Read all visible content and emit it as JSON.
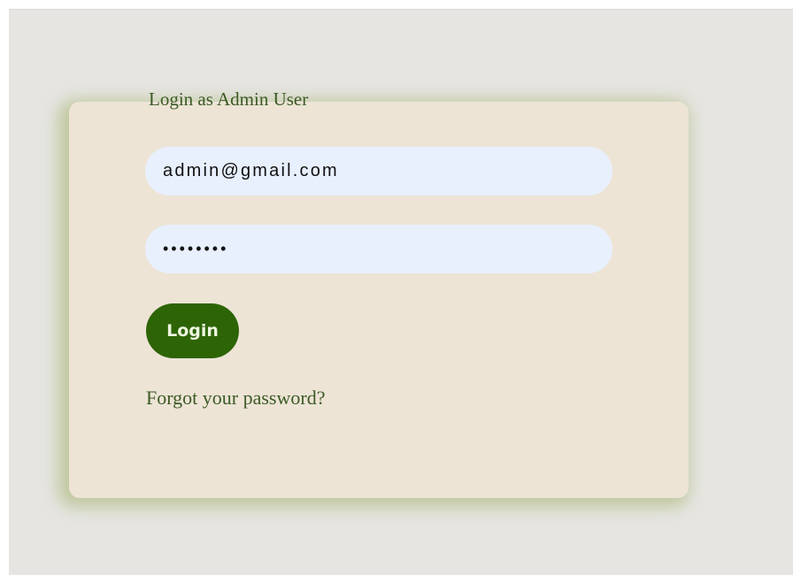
{
  "login_form": {
    "title": "Login as Admin User",
    "email": {
      "value": "admin@gmail.com"
    },
    "password": {
      "value": "••••••••"
    },
    "login_button_label": "Login",
    "forgot_password_label": "Forgot your password?"
  },
  "colors": {
    "page_background": "#e6e5e2",
    "card_background": "#ede4d6",
    "card_shadow": "#a0af64",
    "accent_green": "#2d6406",
    "text_green": "#3b5a25",
    "input_background": "#e8f0fe"
  }
}
